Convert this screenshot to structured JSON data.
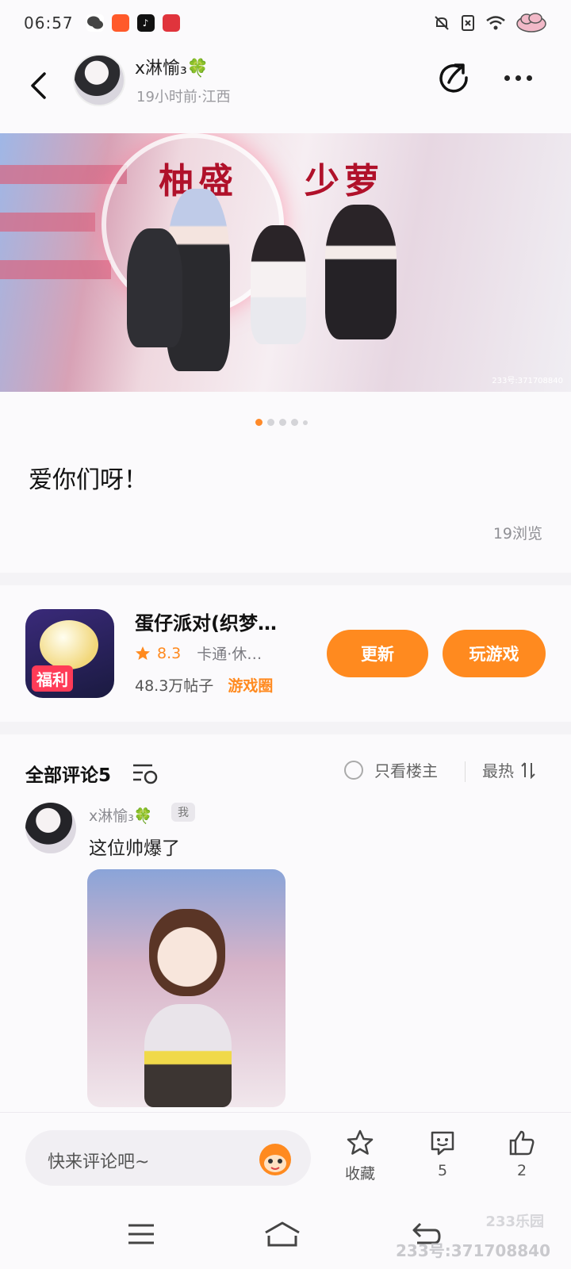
{
  "status_bar": {
    "time": "06:57"
  },
  "header": {
    "author_name": "x淋愉₃🍀",
    "author_meta": "19小时前·江西"
  },
  "banner": {
    "overlay_text_left": "柚盛",
    "overlay_text_right": "少萝",
    "watermark": "233号:371708840",
    "pagination": {
      "count": 5,
      "active_index": 0
    }
  },
  "post": {
    "text": "爱你们呀！",
    "views": "19浏览"
  },
  "game": {
    "name": "蛋仔派对(织梦…",
    "rating": "8.3",
    "genre": "卡通·休…",
    "posts": "48.3万帖子",
    "circle_link": "游戏圈",
    "icon_badge": "福利",
    "update_label": "更新",
    "play_label": "玩游戏"
  },
  "comments": {
    "title": "全部评论5",
    "owner_only_label": "只看楼主",
    "sort_label": "最热",
    "items": [
      {
        "author": "x淋愉₃🍀",
        "badge": "我",
        "text": "这位帅爆了"
      }
    ]
  },
  "action_bar": {
    "input_placeholder": "快来评论吧~",
    "favorite_label": "收藏",
    "comment_count": "5",
    "like_count": "2"
  },
  "watermark": {
    "logo": "233乐园",
    "id": "233号:371708840"
  },
  "colors": {
    "accent": "#ff8a1f",
    "background": "#fbfafc",
    "separator": "#f4f3f6"
  },
  "icons": [
    "back-icon",
    "share-icon",
    "more-icon",
    "star-icon",
    "filter-icon",
    "sort-icon",
    "favorite-icon",
    "comment-icon",
    "like-icon",
    "menu-icon",
    "home-icon",
    "return-icon"
  ]
}
